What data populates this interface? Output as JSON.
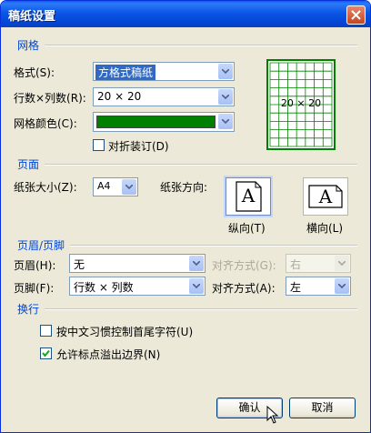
{
  "window": {
    "title": "稿纸设置"
  },
  "sections": {
    "grid": "网格",
    "page": "页面",
    "header_footer": "页眉/页脚",
    "wrap": "换行"
  },
  "grid": {
    "format_label": "格式(S):",
    "format_value": "方格式稿纸",
    "rows_cols_label": "行数×列数(R):",
    "rows_cols_value": "20 × 20",
    "color_label": "网格颜色(C):",
    "color_value": "#008000",
    "fold_label": "对折装订(D)",
    "preview_text": "20 × 20"
  },
  "page": {
    "size_label": "纸张大小(Z):",
    "size_value": "A4",
    "orientation_label": "纸张方向:",
    "portrait_label": "纵向(T)",
    "landscape_label": "横向(L)",
    "icon_letter": "A"
  },
  "header_footer": {
    "header_label": "页眉(H):",
    "header_value": "无",
    "header_align_label": "对齐方式(G):",
    "header_align_value": "右",
    "footer_label": "页脚(F):",
    "footer_value": "行数 × 列数",
    "footer_align_label": "对齐方式(A):",
    "footer_align_value": "左"
  },
  "wrap": {
    "opt1_label": "按中文习惯控制首尾字符(U)",
    "opt1_checked": false,
    "opt2_label": "允许标点溢出边界(N)",
    "opt2_checked": true
  },
  "buttons": {
    "ok": "确认",
    "cancel": "取消"
  }
}
